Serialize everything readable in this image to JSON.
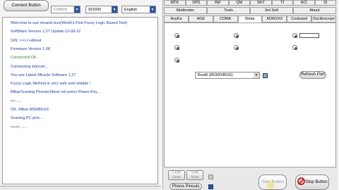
{
  "toolbar": {
    "connect_label": "Connect Button",
    "port_value": "COM15",
    "baud_value": "921600",
    "language_value": "English"
  },
  "log_lines": [
    {
      "text": "Welcome to use miracle box(World's First Fuzzy Logic Based Tool)",
      "color": "#1b3fb0"
    },
    {
      "text": "SoftWare Version 1.27  Update:12-09-12",
      "color": "#1b3fb0"
    },
    {
      "text": "S/N: >>>>>About",
      "color": "#1b3fb0"
    },
    {
      "text": "Firmware Version 1.08",
      "color": "#1b3fb0"
    },
    {
      "text": "Connected OK.",
      "color": "#2a8a2a"
    },
    {
      "text": "Connecting internet...",
      "color": "#1b3fb0"
    },
    {
      "text": "You use Latest Miracle Software 1.27",
      "color": "#1b3fb0"
    },
    {
      "text": "Fuzzy Logic Method is very safe and reliable !",
      "color": "#1b3fb0"
    },
    {
      "text": "MtkarScaning Pinouts,Need not press Power-Key...",
      "color": "#1b3fb0"
    },
    {
      "text": "<<......",
      "color": "#1b3fb0"
    },
    {
      "text": "OK. Mtkar MSM8XXX",
      "color": "#1b3fb0"
    },
    {
      "text": "Scaning PC port...",
      "color": "#1b3fb0"
    },
    {
      "text": ">>>< .....",
      "color": "#1b3fb0"
    }
  ],
  "tabs_row1": [
    "MTK",
    "SPD",
    "INF",
    "QM",
    "SKY",
    "TI",
    "ACI",
    "SI"
  ],
  "tabs_row2": [
    "Multimeter",
    "Tools",
    "3rd Soft",
    "About"
  ],
  "tabs_row3": [
    "AnyKa",
    "AGE",
    "CDMA",
    "Mstar",
    "ADI6XXX",
    "Coolsand",
    "Oscilloscope"
  ],
  "active_tab": "Mstar",
  "chip_value": "Boot6 (8530D/8532)",
  "refresh_label": "Refresh Port",
  "com_scan_1": "COM Scan",
  "usb_scan": "USB Scan",
  "phone_pinouts_label": "Phone Pinouts",
  "start_label": "Start Button",
  "stop_label": "Stop Button",
  "colors": {
    "accent": "#2b56a6",
    "stop_red": "#d02020"
  }
}
